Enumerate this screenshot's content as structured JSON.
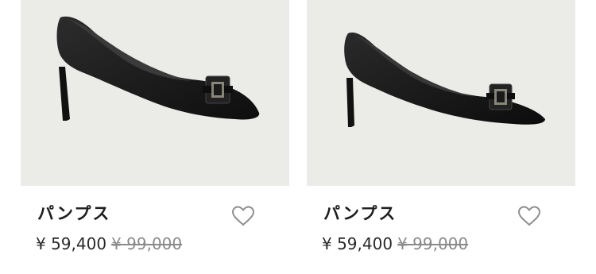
{
  "products": [
    {
      "name": "パンプス",
      "price": "¥ 59,400",
      "original_price": "¥ 99,000",
      "favorite_icon": "heart-outline-icon",
      "image_bg": "#ebebe8",
      "shoe_color": "#151515"
    },
    {
      "name": "パンプス",
      "price": "¥ 59,400",
      "original_price": "¥ 99,000",
      "favorite_icon": "heart-outline-icon",
      "image_bg": "#ebebe8",
      "shoe_color": "#151515"
    }
  ]
}
